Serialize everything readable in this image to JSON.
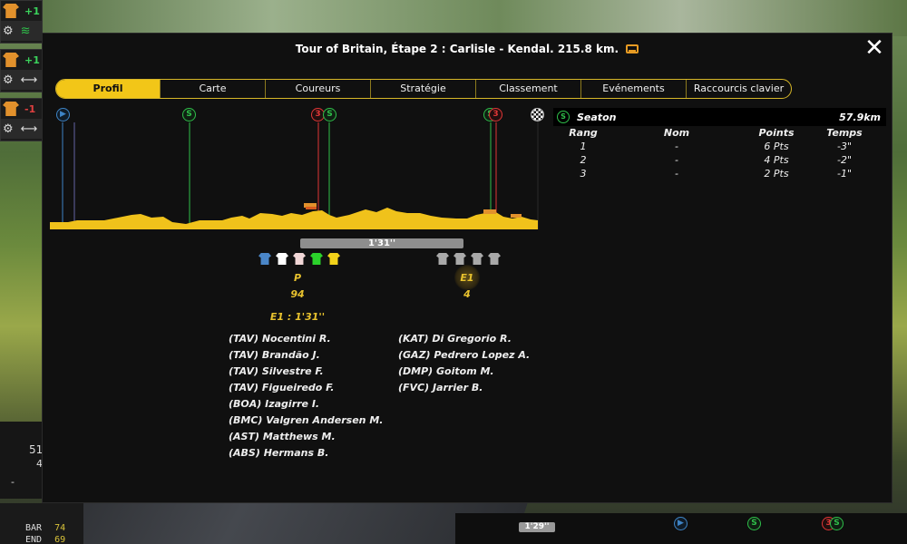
{
  "window": {
    "title": "Tour of Britain, Étape 2 : Carlisle - Kendal. 215.8 km.",
    "close_symbol": "✕"
  },
  "tabs": [
    {
      "label": "Profil",
      "active": true
    },
    {
      "label": "Carte",
      "active": false
    },
    {
      "label": "Coureurs",
      "active": false
    },
    {
      "label": "Stratégie",
      "active": false
    },
    {
      "label": "Classement",
      "active": false
    },
    {
      "label": "Evénements",
      "active": false
    },
    {
      "label": "Raccourcis clavier",
      "active": false
    }
  ],
  "profile": {
    "marker_icons": {
      "start": "play-icon",
      "sprint": "S",
      "climb": "3",
      "finish": "finish-flag-icon"
    },
    "gap_label": "1'31''",
    "groups": [
      {
        "label": "P",
        "count": "94"
      },
      {
        "label": "E1",
        "count": "4"
      }
    ],
    "gap_summary": "E1 : 1'31''",
    "jersey_colors": {
      "peloton": [
        "#4a86c8",
        "#ffffff",
        "#f1d6d6",
        "#2bd12b",
        "#f2d21a"
      ],
      "breakaway": [
        "#a9a9a9",
        "#a9a9a9",
        "#a9a9a9",
        "#a9a9a9"
      ]
    },
    "peloton_riders": [
      "(TAV) Nocentini R.",
      "(TAV) Brandão J.",
      "(TAV) Silvestre F.",
      "(TAV) Figueiredo F.",
      "(BOA) Izagirre I.",
      "(BMC) Valgren Andersen M.",
      "(AST) Matthews M.",
      "(ABS) Hermans B."
    ],
    "breakaway_riders": [
      "(KAT) Di Gregorio R.",
      "(GAZ) Pedrero Lopez A.",
      "(DMP) Goitom M.",
      "(FVC) Jarrier B."
    ]
  },
  "sprint": {
    "icon": "S",
    "name": "Seaton",
    "distance": "57.9km",
    "headers": {
      "rank": "Rang",
      "name": "Nom",
      "points": "Points",
      "time": "Temps"
    },
    "rows": [
      {
        "rank": "1",
        "name": "-",
        "points": "6 Pts",
        "time": "-3\""
      },
      {
        "rank": "2",
        "name": "-",
        "points": "4 Pts",
        "time": "-2\""
      },
      {
        "rank": "3",
        "name": "-",
        "points": "2 Pts",
        "time": "-1\""
      }
    ]
  },
  "hud": {
    "rows": [
      {
        "delta": "+1",
        "delta_color": "#3bd35c"
      },
      {
        "delta": "+1",
        "delta_color": "#3bd35c"
      },
      {
        "delta": "-1",
        "delta_color": "#e04040"
      }
    ],
    "left_value": "51",
    "left_value_small": "4",
    "bottom_dash": "-",
    "bottom_stats": [
      {
        "label": "BAR",
        "value": "74"
      },
      {
        "label": "END",
        "value": "69"
      }
    ],
    "mini_gap": "1'29''"
  },
  "colors": {
    "accent": "#f2c618",
    "profile_fill": "#f0c21b",
    "sprint_line": "#2fbf4a",
    "climb_line": "#e03636",
    "start_line": "#3e84c6"
  }
}
